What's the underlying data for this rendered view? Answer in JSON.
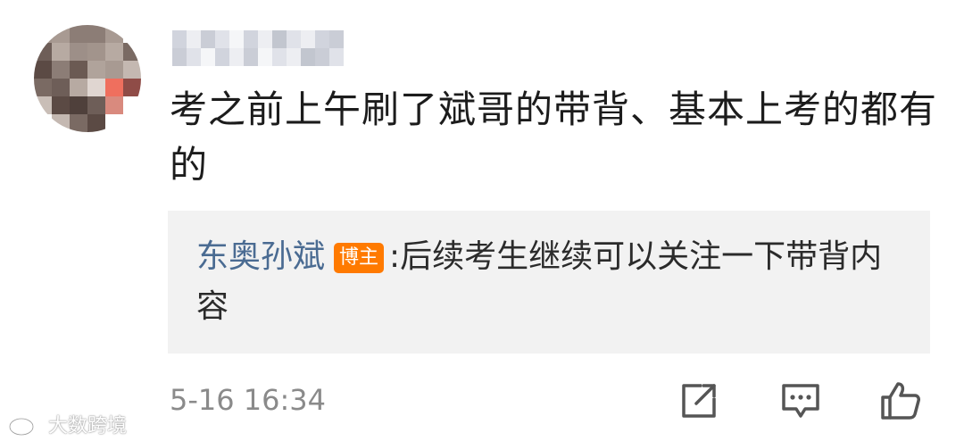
{
  "comment": {
    "text": "考之前上午刷了斌哥的带背、基本上考的都有的",
    "timestamp": "5-16 16:34"
  },
  "reply": {
    "author": "东奥孙斌",
    "badge": "博主",
    "separator": ":",
    "text": "后续考生继续可以关注一下带背内容"
  },
  "actions": {
    "icons": [
      "share-icon",
      "comment-icon",
      "like-icon"
    ]
  },
  "watermark": {
    "text": "大数跨境"
  },
  "colors": {
    "author_link": "#4a6b92",
    "badge_bg": "#ff7a00",
    "reply_bg": "#f2f2f2",
    "timestamp": "#8a8a8a",
    "icon": "#555555"
  }
}
